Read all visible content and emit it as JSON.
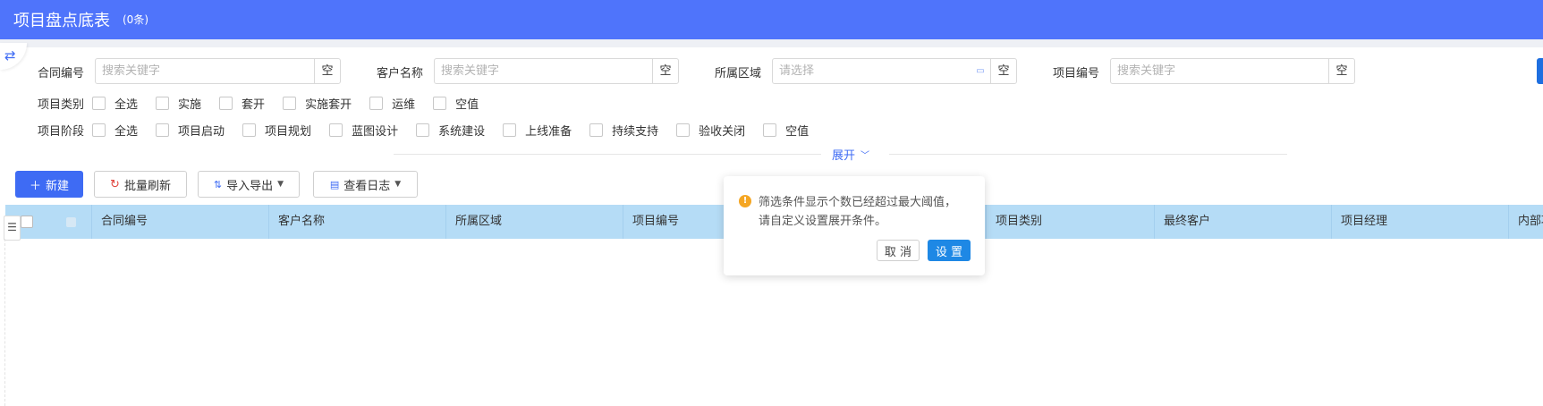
{
  "header": {
    "title": "项目盘点底表",
    "count": "(0条)"
  },
  "filters": {
    "contract_no": {
      "label": "合同编号",
      "placeholder": "搜索关键字",
      "empty": "空"
    },
    "customer": {
      "label": "客户名称",
      "placeholder": "搜索关键字",
      "empty": "空"
    },
    "region": {
      "label": "所属区域",
      "placeholder": "请选择",
      "empty": "空"
    },
    "project_no": {
      "label": "项目编号",
      "placeholder": "搜索关键字",
      "empty": "空"
    },
    "category": {
      "label": "项目类别",
      "options": [
        "全选",
        "实施",
        "套开",
        "实施套开",
        "运维",
        "空值"
      ]
    },
    "stage": {
      "label": "项目阶段",
      "options": [
        "全选",
        "项目启动",
        "项目规划",
        "蓝图设计",
        "系统建设",
        "上线准备",
        "持续支持",
        "验收关闭",
        "空值"
      ]
    },
    "expand_label": "展开"
  },
  "toolbar": {
    "new": "新建",
    "batch_refresh": "批量刷新",
    "import_export": "导入导出",
    "view_log": "查看日志"
  },
  "table": {
    "columns": [
      "合同编号",
      "客户名称",
      "所属区域",
      "项目编号",
      "项目类别",
      "最终客户",
      "项目经理",
      "内部项"
    ]
  },
  "popover": {
    "message_line1": "筛选条件显示个数已经超过最大阈值，",
    "message_line2": "请自定义设置展开条件。",
    "cancel": "取 消",
    "confirm": "设 置"
  },
  "icons": {
    "toggle": "swap-icon",
    "warning": "warning-icon"
  },
  "colors": {
    "header": "#4f74fb",
    "primary": "#3e6bf4",
    "table_header": "#b5dcf6",
    "warning": "#f5a623",
    "confirm": "#1e88e5"
  }
}
